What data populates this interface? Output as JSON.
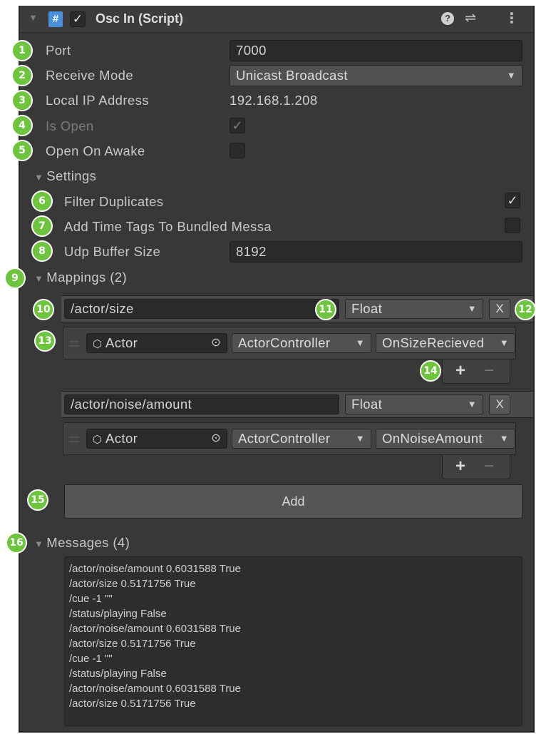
{
  "component": {
    "title": "Osc In (Script)",
    "enabled": true,
    "script_icon_label": "#"
  },
  "fields": {
    "port": {
      "label": "Port",
      "value": "7000"
    },
    "receive_mode": {
      "label": "Receive Mode",
      "value": "Unicast Broadcast"
    },
    "local_ip": {
      "label": "Local IP Address",
      "value": "192.168.1.208"
    },
    "is_open": {
      "label": "Is Open",
      "checked": true
    },
    "open_on_awake": {
      "label": "Open On Awake",
      "checked": false
    }
  },
  "settings": {
    "label": "Settings",
    "filter_duplicates": {
      "label": "Filter Duplicates",
      "checked": true
    },
    "add_time_tags": {
      "label": "Add Time Tags To Bundled Messa",
      "checked": false
    },
    "udp_buffer_size": {
      "label": "Udp Buffer Size",
      "value": "8192"
    }
  },
  "mappings": {
    "label": "Mappings (2)",
    "items": [
      {
        "address": "/actor/size",
        "type": "Float",
        "remove": "X",
        "target": "Actor",
        "component": "ActorController",
        "method": "OnSizeRecieved",
        "add": "+",
        "minus": "−"
      },
      {
        "address": "/actor/noise/amount",
        "type": "Float",
        "remove": "X",
        "target": "Actor",
        "component": "ActorController",
        "method": "OnNoiseAmount",
        "add": "+",
        "minus": "−"
      }
    ],
    "add_button": "Add"
  },
  "messages": {
    "label": "Messages (4)",
    "lines": [
      "/actor/noise/amount 0.6031588 True",
      "/actor/size 0.5171756 True",
      "/cue -1 \"\"",
      "/status/playing False",
      "/actor/noise/amount 0.6031588 True",
      "/actor/size 0.5171756 True",
      "/cue -1 \"\"",
      "/status/playing False",
      "/actor/noise/amount 0.6031588 True",
      "/actor/size 0.5171756 True"
    ]
  },
  "badges": [
    "1",
    "2",
    "3",
    "4",
    "5",
    "6",
    "7",
    "8",
    "9",
    "10",
    "11",
    "12",
    "13",
    "14",
    "15",
    "16"
  ],
  "colors": {
    "badge": "#6ec33f",
    "panel": "#383838",
    "field": "#2a2a2a",
    "dropdown": "#515151"
  }
}
